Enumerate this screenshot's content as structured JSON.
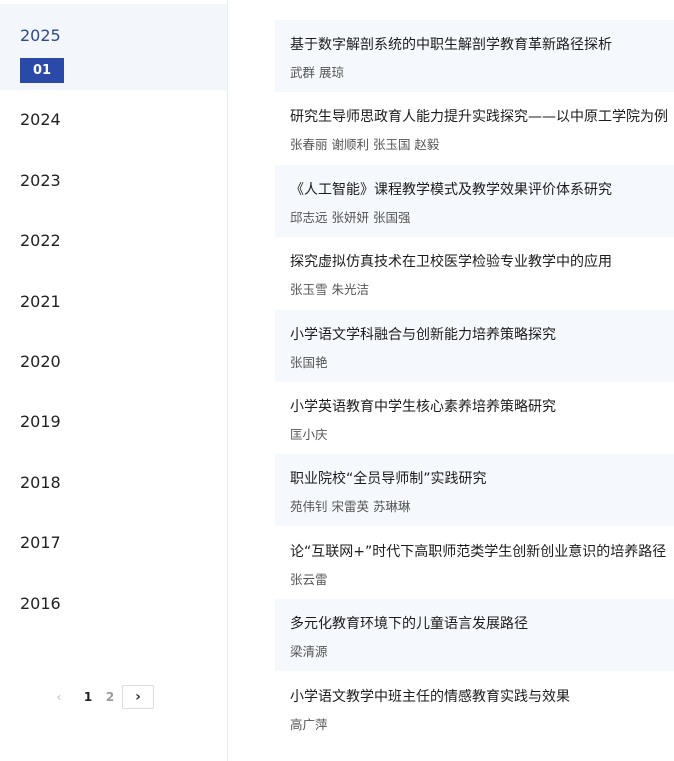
{
  "sidebar": {
    "active_year": "2025",
    "active_issue": "01",
    "years": [
      "2024",
      "2023",
      "2022",
      "2021",
      "2020",
      "2019",
      "2018",
      "2017",
      "2016"
    ]
  },
  "pagination": {
    "prev_icon": "‹",
    "pages": [
      "1",
      "2"
    ],
    "current_page": "1",
    "next_icon": "›"
  },
  "articles": [
    {
      "title": "基于数字解剖系统的中职生解剖学教育革新路径探析",
      "authors": "武群  展琼"
    },
    {
      "title": "研究生导师思政育人能力提升实践探究——以中原工学院为例",
      "authors": "张春丽  谢顺利  张玉国  赵毅"
    },
    {
      "title": "《人工智能》课程教学模式及教学效果评价体系研究",
      "authors": "邱志远  张妍妍  张国强"
    },
    {
      "title": "探究虚拟仿真技术在卫校医学检验专业教学中的应用",
      "authors": "张玉雪  朱光洁"
    },
    {
      "title": "小学语文学科融合与创新能力培养策略探究",
      "authors": "张国艳"
    },
    {
      "title": "小学英语教育中学生核心素养培养策略研究",
      "authors": "匡小庆"
    },
    {
      "title": "职业院校“全员导师制”实践研究",
      "authors": "苑伟钊  宋雷英  苏琳琳"
    },
    {
      "title": "论“互联网+”时代下高职师范类学生创新创业意识的培养路径",
      "authors": "张云雷"
    },
    {
      "title": "多元化教育环境下的儿童语言发展路径",
      "authors": "梁清源"
    },
    {
      "title": "小学语文教学中班主任的情感教育实践与效果",
      "authors": "高广萍"
    }
  ]
}
